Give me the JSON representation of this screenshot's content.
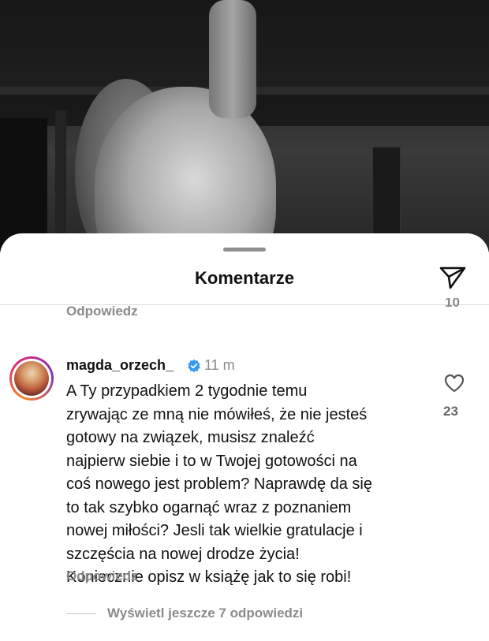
{
  "sheet": {
    "title": "Komentarze"
  },
  "top_reply": {
    "reply_label": "Odpowiedz",
    "like_count_partial": "10"
  },
  "comment": {
    "username": "magda_orzech_",
    "time": "11 m",
    "lines": [
      "A Ty przypadkiem 2 tygodnie temu",
      "zrywając ze mną nie mówiłeś, że nie jesteś",
      "gotowy na związek, musisz znaleźć",
      "najpierw siebie i to w Twojej gotowości na",
      "coś nowego jest problem? Naprawdę da się",
      "to tak szybko ogarnąć wraz z poznaniem",
      "nowej miłości? Jesli tak wielkie gratulacje i",
      "szczęścia na nowej drodze życia!",
      "Koniecznie opisz w książę jak to się robi!"
    ],
    "like_count": "23",
    "reply_label": "Odpowiedz",
    "view_more": "Wyświetl jeszcze 7 odpowiedzi"
  },
  "icons": {
    "send": "send-icon",
    "heart": "heart-icon",
    "verified": "verified-badge-icon"
  },
  "colors": {
    "verified_blue": "#3897f0",
    "secondary_text": "#8a8a8a"
  }
}
